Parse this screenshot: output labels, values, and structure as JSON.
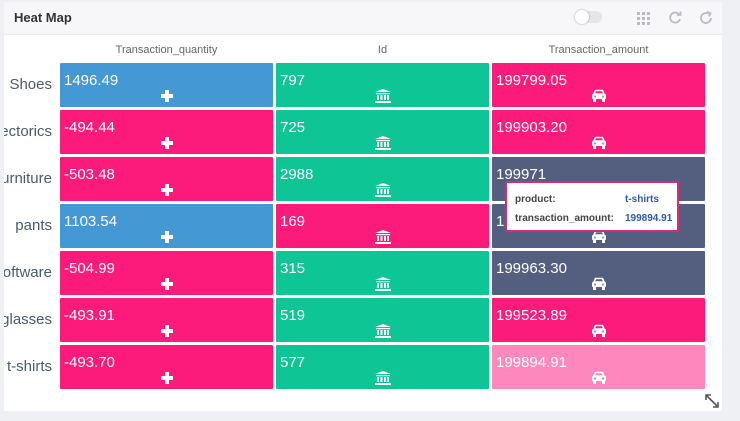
{
  "panel": {
    "title": "Heat Map",
    "toggle_on": false,
    "icons": [
      "grid-icon",
      "refresh-icon",
      "reload-icon"
    ]
  },
  "columns": [
    "Transaction_quantity",
    "Id",
    "Transaction_amount"
  ],
  "column_icons": [
    "plus-icon",
    "bank-icon",
    "car-icon"
  ],
  "rows": [
    {
      "label": "Shoes",
      "values": [
        "1496.49",
        "797",
        "199799.05"
      ]
    },
    {
      "label": "Electorics",
      "values": [
        "-494.44",
        "725",
        "199903.20"
      ]
    },
    {
      "label": "Furniture",
      "values": [
        "-503.48",
        "2988",
        "199971"
      ]
    },
    {
      "label": "pants",
      "values": [
        "1103.54",
        "169",
        "1"
      ]
    },
    {
      "label": "Software",
      "values": [
        "-504.99",
        "315",
        "199963.30"
      ]
    },
    {
      "label": "glasses",
      "values": [
        "-493.91",
        "519",
        "199523.89"
      ]
    },
    {
      "label": "t-shirts",
      "values": [
        "-493.70",
        "577",
        "199894.91"
      ]
    }
  ],
  "cell_colors": [
    [
      "#4499d4",
      "#0ec595",
      "#fc1a7a"
    ],
    [
      "#fc1a7a",
      "#0ec595",
      "#fc1a7a"
    ],
    [
      "#fc1a7a",
      "#0ec595",
      "#545f80"
    ],
    [
      "#4499d4",
      "#fc1a7a",
      "#545f80"
    ],
    [
      "#fc1a7a",
      "#0ec595",
      "#545f80"
    ],
    [
      "#fc1a7a",
      "#0ec595",
      "#fc1a7a"
    ],
    [
      "#fc1a7a",
      "#0ec595",
      "#fe88be"
    ]
  ],
  "tooltip": {
    "product_key": "product:",
    "product_value": "t-shirts",
    "amount_key": "transaction_amount:",
    "amount_value": "199894.91"
  }
}
